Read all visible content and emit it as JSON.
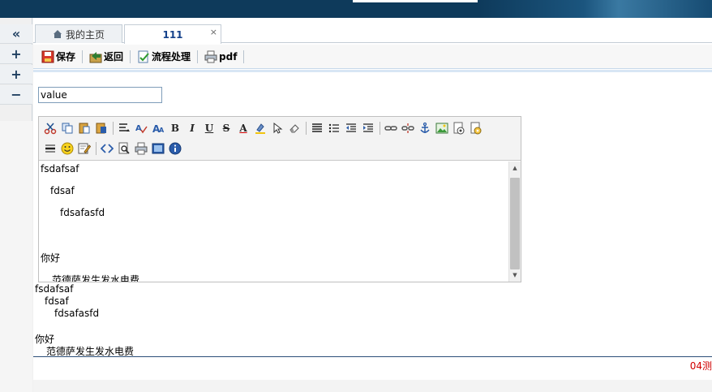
{
  "sidebar": {
    "collapse_icon": "double-chevron-left",
    "buttons": [
      "+",
      "+",
      "−"
    ]
  },
  "tabs": [
    {
      "label": "我的主页",
      "icon": "home-icon",
      "active": false
    },
    {
      "label": "111",
      "active": true,
      "close": "×"
    }
  ],
  "actions": {
    "save": "保存",
    "back": "返回",
    "workflow": "流程处理",
    "pdf": "pdf"
  },
  "form": {
    "value_field": "value"
  },
  "editor": {
    "toolbar_row1": [
      "cut-icon",
      "copy-icon",
      "paste-icon",
      "paste-word-icon",
      "align-icon",
      "spellcheck-icon",
      "font-size-icon",
      "bold-icon",
      "italic-icon",
      "underline-icon",
      "strikethrough-icon",
      "font-color-icon",
      "highlight-icon",
      "select-icon",
      "eraser-icon",
      "justify-icon",
      "unordered-list-icon",
      "outdent-icon",
      "indent-icon",
      "link-icon",
      "unlink-icon",
      "anchor-icon",
      "image-icon",
      "flash-icon",
      "media-icon"
    ],
    "toolbar_row2": [
      "horizontal-rule-icon",
      "emoticon-icon",
      "template-icon",
      "source-icon",
      "preview-icon",
      "print-icon",
      "fullscreen-icon",
      "about-icon"
    ],
    "bold_label": "B",
    "italic_label": "I",
    "underline_label": "U",
    "strike_label": "S",
    "font_color_label": "A",
    "lines": [
      {
        "text": "fsdafsaf",
        "indent": 0
      },
      {
        "text": "fdsaf",
        "indent": 1
      },
      {
        "text": "fdsafasfd",
        "indent": 2
      },
      {
        "text": "你好",
        "indent": 0
      },
      {
        "text": "范德萨发生发水电费",
        "indent": 1
      }
    ]
  },
  "preview": {
    "lines": [
      {
        "text": "fsdafsaf",
        "indent": 0
      },
      {
        "text": "fdsaf",
        "indent": 1
      },
      {
        "text": "fdsafasfd",
        "indent": 2
      },
      {
        "text": "",
        "indent": 0
      },
      {
        "text": "你好",
        "indent": 0
      },
      {
        "text": "范德萨发生发水电费",
        "indent": 1
      }
    ]
  },
  "status": {
    "red_text": "04测"
  },
  "colors": {
    "banner": "#0e3a5b",
    "tab_active_text": "#15428b",
    "status_red": "#d00000"
  }
}
